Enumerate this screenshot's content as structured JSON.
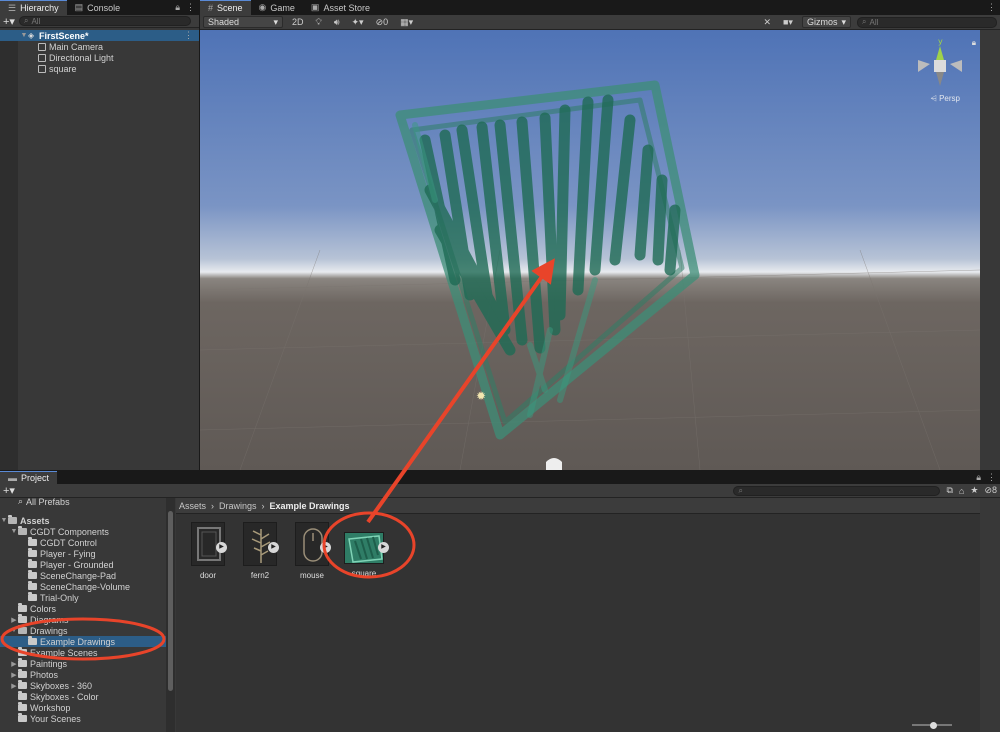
{
  "hierarchy": {
    "tabs": [
      {
        "label": "Hierarchy",
        "icon": "list-icon"
      },
      {
        "label": "Console",
        "icon": "console-icon"
      }
    ],
    "search_placeholder": "All",
    "scene_name": "FirstScene*",
    "objects": [
      "Main Camera",
      "Directional Light",
      "square"
    ]
  },
  "scene": {
    "tabs": [
      {
        "label": "Scene",
        "icon": "grid-icon"
      },
      {
        "label": "Game",
        "icon": "gamepad-icon"
      },
      {
        "label": "Asset Store",
        "icon": "store-icon"
      }
    ],
    "shading_mode": "Shaded",
    "mode_2d": "2D",
    "hidden_count": "0",
    "gizmos_label": "Gizmos",
    "search_placeholder": "All",
    "perspective_label": "Persp",
    "gizmo_y_label": "y"
  },
  "project": {
    "tab_label": "Project",
    "hidden_count": "8",
    "favorites": [
      "All Prefabs"
    ],
    "breadcrumb": [
      "Assets",
      "Drawings",
      "Example Drawings"
    ],
    "tree": [
      {
        "label": "Assets",
        "level": 0,
        "open": true,
        "bold": true
      },
      {
        "label": "CGDT Components",
        "level": 1,
        "open": true
      },
      {
        "label": "CGDT Control",
        "level": 2
      },
      {
        "label": "Player - Fying",
        "level": 2
      },
      {
        "label": "Player - Grounded",
        "level": 2
      },
      {
        "label": "SceneChange-Pad",
        "level": 2
      },
      {
        "label": "SceneChange-Volume",
        "level": 2
      },
      {
        "label": "Trial-Only",
        "level": 2
      },
      {
        "label": "Colors",
        "level": 1
      },
      {
        "label": "Diagrams",
        "level": 1,
        "collapsed": true
      },
      {
        "label": "Drawings",
        "level": 1,
        "open": true
      },
      {
        "label": "Example Drawings",
        "level": 2,
        "selected": true
      },
      {
        "label": "Example Scenes",
        "level": 1
      },
      {
        "label": "Paintings",
        "level": 1,
        "collapsed": true
      },
      {
        "label": "Photos",
        "level": 1,
        "collapsed": true
      },
      {
        "label": "Skyboxes - 360",
        "level": 1,
        "collapsed": true
      },
      {
        "label": "Skyboxes - Color",
        "level": 1
      },
      {
        "label": "Workshop",
        "level": 1
      },
      {
        "label": "Your Scenes",
        "level": 1
      }
    ],
    "assets": [
      "door",
      "fern2",
      "mouse",
      "square"
    ]
  },
  "colors": {
    "annotation_red": "#e8442a",
    "drawing_green": "#2f8a6e",
    "selection_blue": "#2c5d87"
  }
}
